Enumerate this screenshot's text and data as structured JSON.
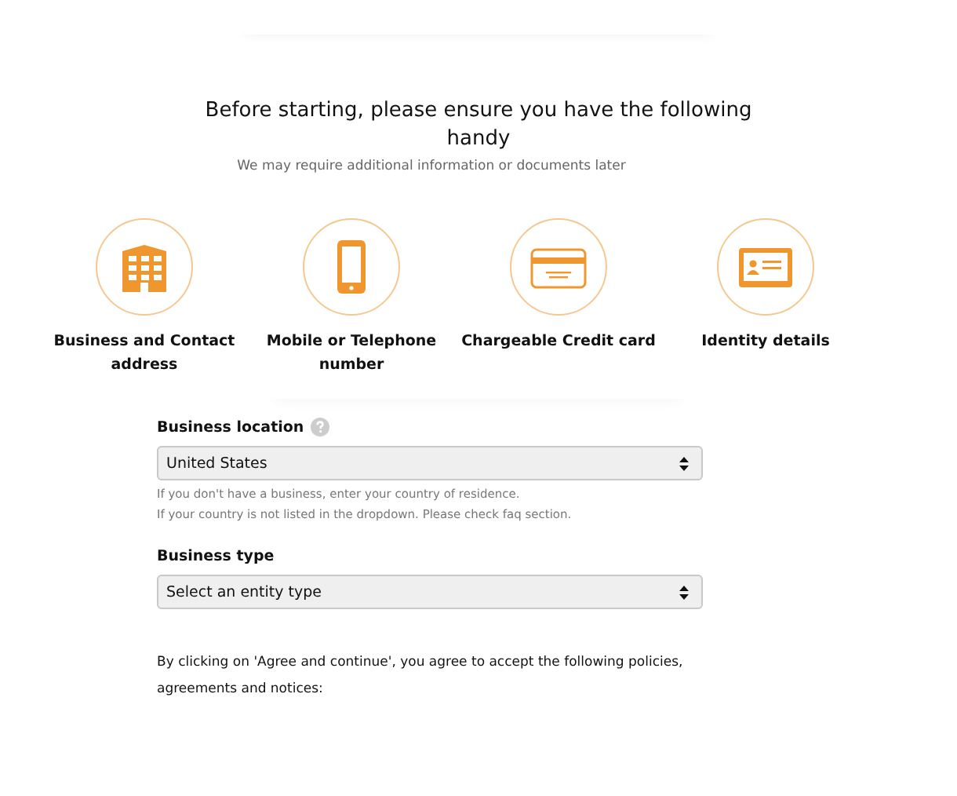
{
  "heading": "Before starting, please ensure you have the following handy",
  "subheading": "We may require additional information or documents later",
  "requirements": [
    {
      "kind": "building",
      "label": "Business and Contact address"
    },
    {
      "kind": "phone",
      "label": "Mobile or Telephone number"
    },
    {
      "kind": "card",
      "label": "Chargeable Credit card"
    },
    {
      "kind": "id",
      "label": "Identity details"
    }
  ],
  "business_location": {
    "label": "Business location",
    "value": "United States",
    "hints": [
      "If you don't have a business, enter your country of residence.",
      "If your country is not listed in the dropdown. Please check faq section."
    ]
  },
  "business_type": {
    "label": "Business type",
    "value": "Select an entity type"
  },
  "agreement_text": "By clicking on 'Agree and continue', you agree to accept the following policies, agreements and notices:"
}
